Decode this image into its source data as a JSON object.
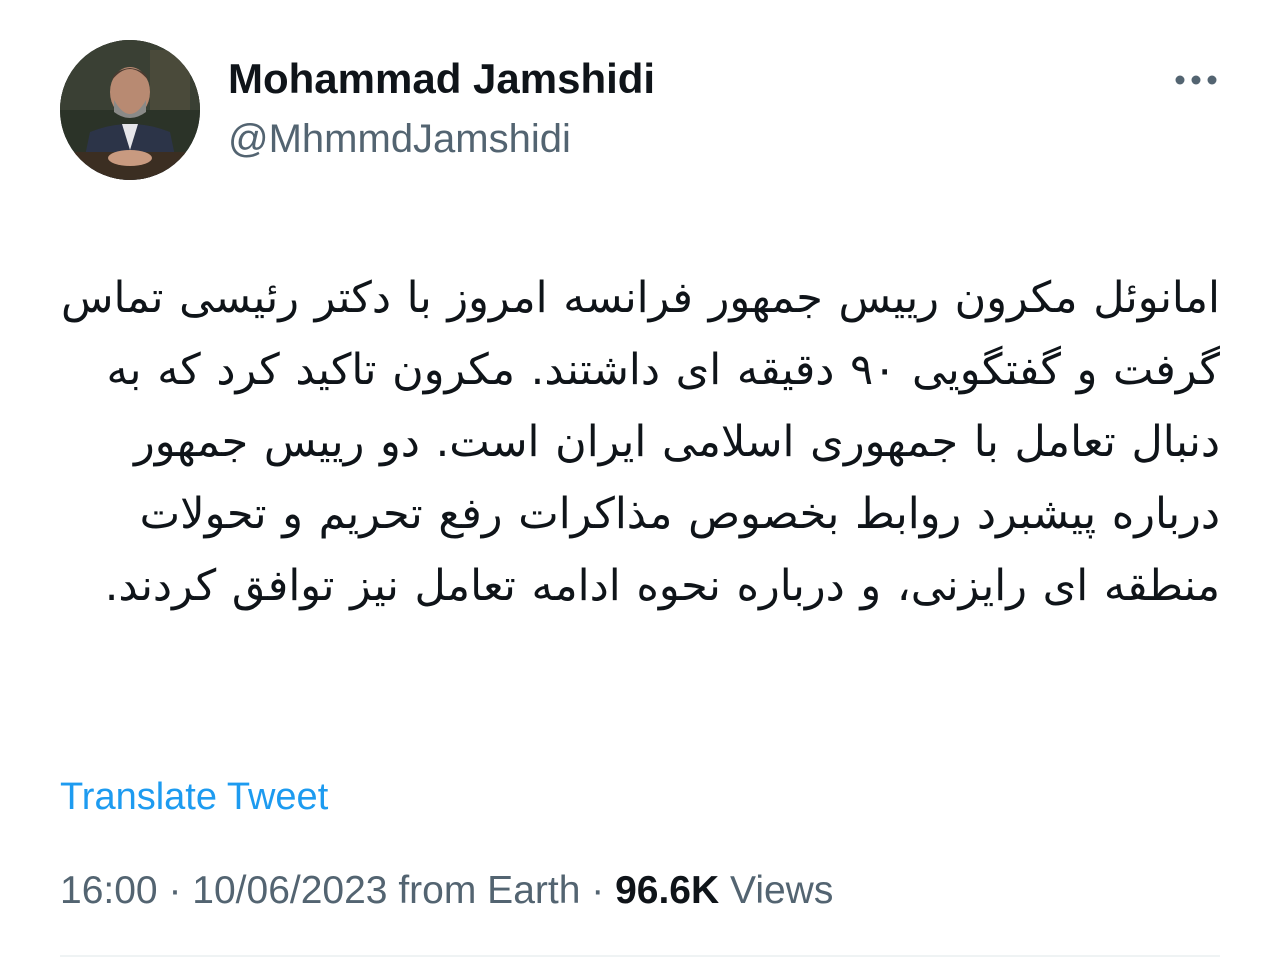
{
  "author": {
    "name": "Mohammad Jamshidi",
    "handle": "@MhmmdJamshidi"
  },
  "tweet": {
    "text": "امانوئل مکرون رییس جمهور فرانسه امروز با دکتر رئیسی تماس گرفت و گفتگویی ۹۰ دقیقه ای داشتند. مکرون تاکید کرد که به دنبال تعامل با جمهوری اسلامی ایران است. دو رییس جمهور درباره پیشبرد روابط بخصوص مذاکرات رفع تحریم و تحولات منطقه ای رایزنی، و درباره نحوه ادامه تعامل نیز توافق کردند."
  },
  "actions": {
    "translate_label": "Translate Tweet",
    "more_icon": "more-horizontal-icon"
  },
  "meta": {
    "time": "16:00",
    "date": "10/06/2023",
    "source": "from Earth",
    "views_count": "96.6K",
    "views_label": "Views",
    "separator": "·"
  },
  "colors": {
    "link": "#1d9bf0",
    "secondary_text": "#536471",
    "primary_text": "#0f1419",
    "divider": "#eff3f4"
  }
}
